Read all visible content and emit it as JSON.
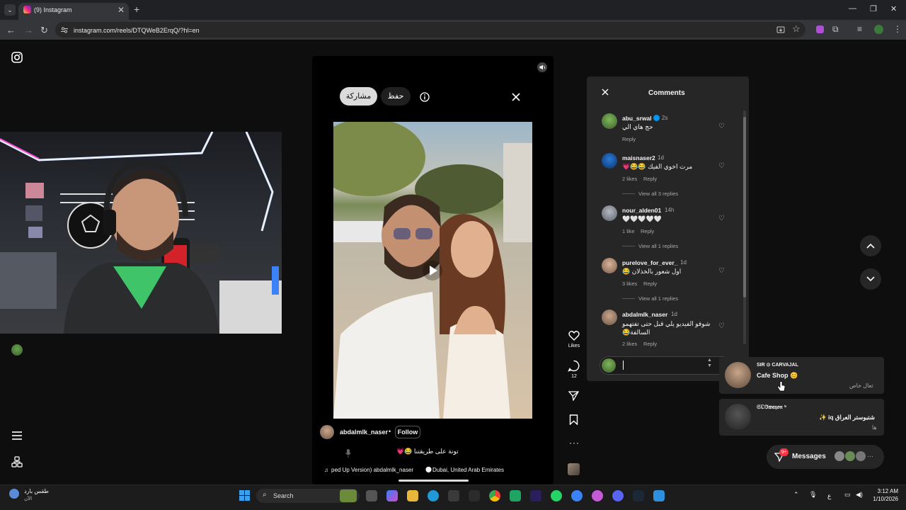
{
  "browser": {
    "tab_title": "(9) Instagram",
    "tab_close": "✕",
    "new_tab": "+",
    "url": "instagram.com/reels/DTQWeB2ErqQ/?hl=en",
    "controls": {
      "minimize": "—",
      "maximize": "❐",
      "close": "✕"
    }
  },
  "reel": {
    "share_label": "مشاركة",
    "save_label": "حفظ",
    "author": "abdalmlk_naser",
    "dot": "•",
    "follow_label": "Follow",
    "caption": "تونة على طريقتنا 😂💗",
    "audio": "ped Up Version)  abdalmlk_naser",
    "location": "Dubai, United Arab Emirates"
  },
  "actions": {
    "likes_label": "Likes",
    "comments_count": "12"
  },
  "comments": {
    "title": "Comments",
    "items": [
      {
        "user": "abu_srwal",
        "verified": true,
        "time": "2s",
        "text": "حج هاي الي",
        "likes": "",
        "reply": "Reply",
        "view_replies": ""
      },
      {
        "user": "maisnaser2",
        "verified": false,
        "time": "1d",
        "text": "مرت اخوي الفيك 😂😂💗",
        "likes": "2 likes",
        "reply": "Reply",
        "view_replies": "View all 3 replies"
      },
      {
        "user": "nour_alden01",
        "verified": false,
        "time": "14h",
        "text": "🤍🤍🤍🤍🤍",
        "likes": "1 like",
        "reply": "Reply",
        "view_replies": "View all 1 replies"
      },
      {
        "user": "purelove_for_ever_",
        "verified": false,
        "time": "1d",
        "text": "اول شعور بالخذلان 😂",
        "likes": "3 likes",
        "reply": "Reply",
        "view_replies": "View all 1 replies"
      },
      {
        "user": "abdalmlk_naser",
        "verified": false,
        "time": "1d",
        "text": "شوفو الفيديو يلي قبل حتى تفتهمو السالفة😂",
        "likes": "2 likes",
        "reply": "Reply",
        "view_replies": ""
      }
    ]
  },
  "dms": [
    {
      "name": "SIR ⊙ CARVAJAL",
      "message": "Cafe Shop 😊",
      "sub": "تعال خاص"
    },
    {
      "name": "𝔖𝔒ℑ𝔴𝔞𝔶𝔬𝔫 ⁵",
      "message": "شتبوستر العراق iq ✨",
      "sub": "ها"
    }
  ],
  "messages": {
    "label": "Messages",
    "badge": "9+"
  },
  "taskbar": {
    "weather_label": "طقس بارد",
    "weather_sub": "الآن",
    "search_label": "Search",
    "time": "3:12 AM",
    "date": "1/10/2026",
    "lang": "ع"
  },
  "colors": {
    "accent_blue": "#0095f6",
    "panel": "#262626",
    "badge_red": "#ff3040"
  }
}
